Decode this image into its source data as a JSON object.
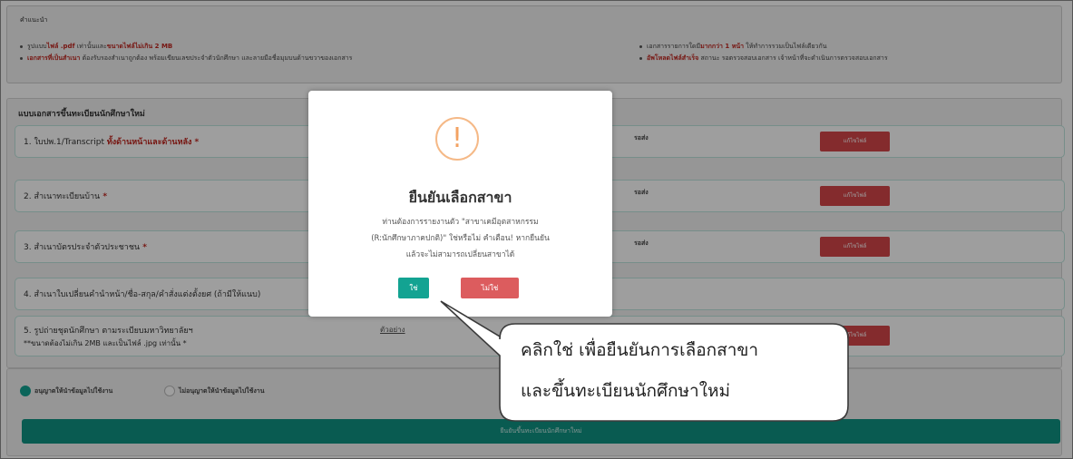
{
  "notice": {
    "title": "คำแนะนำ",
    "line1_prefix": "รูปแบบ",
    "line1_red1": "ไฟล์ .pdf",
    "line1_mid": " เท่านั้นและ",
    "line1_red2": "ขนาดไฟล์ไม่เกิน 2 MB",
    "line2_red": "เอกสารที่เป็นสำเนา",
    "line2_rest": " ต้องรับรองสำเนาถูกต้อง พร้อมเขียนเลขประจำตัวนักศึกษา และลายมือชื่อมุมบนด้านขวาของเอกสาร",
    "line3_prefix": "เอกสารรายการใดมี",
    "line3_red": "มากกว่า 1 หน้า",
    "line3_rest": " ให้ทำการรวมเป็นไฟล์เดียวกัน",
    "line4_red": "อัพโหลดไฟล์สำเร็จ",
    "line4_rest": " สถานะ รอตรวจสอบเอกสาร เจ้าหน้าที่จะดำเนินการตรวจสอบเอกสาร"
  },
  "section": {
    "title": "แบบเอกสารขึ้นทะเบียนนักศึกษาใหม่",
    "rows": [
      {
        "label": "1. ใบปพ.1/Transcript ",
        "red": "ทั้งด้านหน้าและด้านหลัง",
        "star": " *",
        "status": "รอส่ง",
        "button": "แก้ไขไฟล์"
      },
      {
        "label": "2. สำเนาทะเบียนบ้าน",
        "star": " *",
        "status": "รอส่ง",
        "button": "แก้ไขไฟล์"
      },
      {
        "label": "3. สำเนาบัตรประจำตัวประชาชน",
        "star": " *",
        "status": "รอส่ง",
        "button": "แก้ไขไฟล์"
      },
      {
        "label": "4. สำเนาใบเปลี่ยนคำนำหน้า/ชื่อ-สกุล/คำสั่งแต่งตั้งยศ (ถ้ามีให้แนบ)"
      },
      {
        "label": "5. รูปถ่ายชุดนักศึกษา ตามระเบียบมหาวิทยาลัยฯ",
        "label2": "**ขนาดต้องไม่เกิน 2MB และเป็นไฟล์ .jpg เท่านั้น *",
        "link": "ตัวอย่าง",
        "button": "แก้ไขไฟล์"
      }
    ]
  },
  "consent": {
    "option_allow": "อนุญาตให้นำข้อมูลไปใช้งาน",
    "option_deny": "ไม่อนุญาตให้นำข้อมูลไปใช้งาน",
    "selected": "allow",
    "submit": "ยืนยันขึ้นทะเบียนนักศึกษาใหม่"
  },
  "modal": {
    "icon": "!",
    "title": "ยืนยันเลือกสาขา",
    "body_line1": "ท่านต้องการรายงานตัว \"สาขาเคมีอุตสาหกรรม",
    "body_line2": "(R:นักศึกษาภาคปกติ)\" ใช่หรือไม่ คำเตือน! หากยืนยัน",
    "body_line3": "แล้วจะไม่สามารถเปลี่ยนสาขาได้",
    "yes": "ใช่",
    "no": "ไม่ใช่"
  },
  "callout": {
    "line1": "คลิกใช่ เพื่อยืนยันการเลือกสาขา",
    "line2": "และขึ้นทะเบียนนักศึกษาใหม่"
  },
  "colors": {
    "accent": "#13a392",
    "danger": "#d6464a",
    "warning": "#f3a262"
  }
}
